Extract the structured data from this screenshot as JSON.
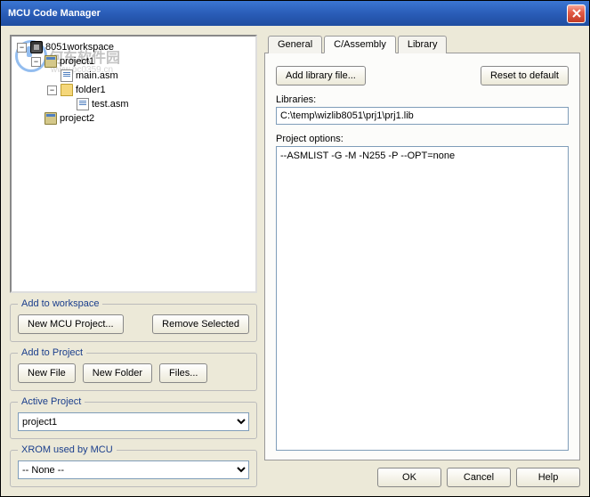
{
  "window": {
    "title": "MCU Code Manager"
  },
  "watermark": {
    "text": "何东软件园",
    "sub": "www.pc0359.cn"
  },
  "tree": {
    "root": "8051workspace",
    "p1": "project1",
    "f_main": "main.asm",
    "folder1": "folder1",
    "f_test": "test.asm",
    "p2": "project2"
  },
  "groups": {
    "add_workspace": {
      "title": "Add to workspace",
      "new_proj": "New MCU Project...",
      "remove": "Remove Selected"
    },
    "add_project": {
      "title": "Add to Project",
      "new_file": "New File",
      "new_folder": "New Folder",
      "files": "Files..."
    },
    "active": {
      "title": "Active Project",
      "value": "project1"
    },
    "xrom": {
      "title": "XROM used by MCU",
      "value": "-- None --"
    }
  },
  "tabs": {
    "general": "General",
    "casm": "C/Assembly",
    "library": "Library"
  },
  "panel": {
    "add_lib": "Add library file...",
    "reset": "Reset to default",
    "lib_label": "Libraries:",
    "lib_value": "C:\\temp\\wizlib8051\\prj1\\prj1.lib",
    "opts_label": "Project options:",
    "opts_value": "--ASMLIST -G -M -N255 -P --OPT=none"
  },
  "buttons": {
    "ok": "OK",
    "cancel": "Cancel",
    "help": "Help"
  }
}
